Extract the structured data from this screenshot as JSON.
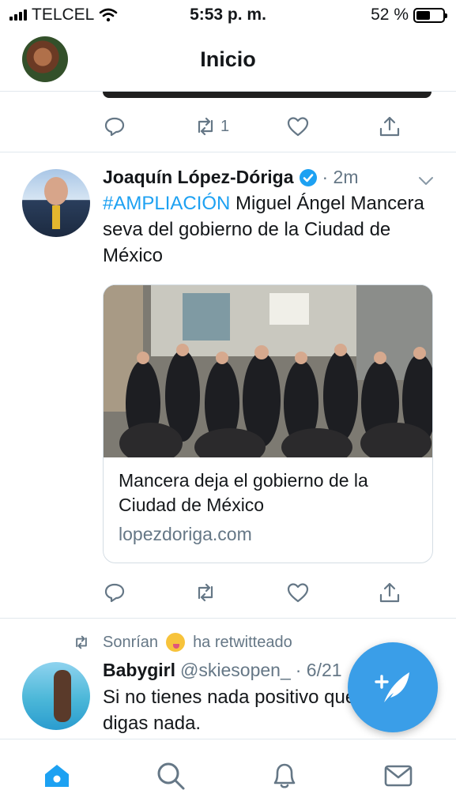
{
  "status_bar": {
    "carrier": "TELCEL",
    "time": "5:53 p. m.",
    "battery_percent_label": "52 %",
    "battery_level": 0.52
  },
  "header": {
    "title": "Inicio"
  },
  "previous_tweet": {
    "retweet_count": "1"
  },
  "tweet": {
    "author_name": "Joaquín López-Dóriga",
    "timestamp": "· 2m",
    "hashtag": "#AMPLIACIÓN",
    "text": " Miguel Ángel Mancera seva del gobierno de la Ciudad de México",
    "card": {
      "title": "Mancera deja el gobierno de la Ciudad de México",
      "domain": "lopezdoriga.com"
    }
  },
  "retweet_notice": {
    "user": "Sonrían",
    "suffix": "ha retwitteado"
  },
  "next_tweet": {
    "author_name": "Babygirl",
    "handle": "@skiesopen_",
    "timestamp": "· 6/21",
    "text": "Si no tienes nada positivo que decir, no digas nada."
  },
  "colors": {
    "accent": "#1da1f2",
    "muted": "#657786",
    "fab": "#3a9ee8"
  },
  "icons": {
    "tabs": [
      "home-icon",
      "search-icon",
      "notifications-icon",
      "messages-icon"
    ],
    "actions": [
      "reply-icon",
      "retweet-icon",
      "like-icon",
      "share-icon"
    ]
  }
}
